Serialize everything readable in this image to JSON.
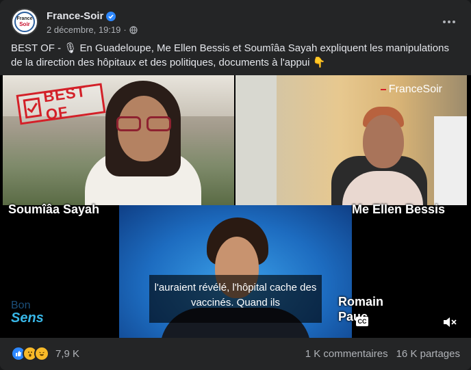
{
  "post": {
    "page_name": "France-Soir",
    "timestamp": "2 décembre, 19:19",
    "separator": "·",
    "caption_prefix": "BEST OF - ",
    "caption_text": " En Guadeloupe, Me Ellen Bessis et Soumîâa Sayah expliquent les manipulations de la direction des hôpitaux et des politiques, documents à l'appui ",
    "mic_emoji": "🎙",
    "point_emoji": "👇",
    "avatar_line1": "France",
    "avatar_line2": "Soir"
  },
  "video": {
    "stamp_text": "BEST OF",
    "logo_text": "FranceSoir",
    "participants": [
      {
        "name": "Soumîâa Sayah"
      },
      {
        "name": "Me Ellen Bessis"
      },
      {
        "name": "Romain Pauc"
      }
    ],
    "subtitle": "l'auraient révélé, l'hôpital cache des vaccinés. Quand ils",
    "show_line1": "Bon",
    "show_line2": "Sens",
    "cc_label": "CC"
  },
  "footer": {
    "reaction_count": "7,9 K",
    "comments": "1 K commentaires",
    "shares": "16 K partages"
  },
  "colors": {
    "background": "#18191a",
    "card": "#242526",
    "text": "#e4e6eb",
    "secondary_text": "#b0b3b8",
    "accent_blue": "#2d88ff",
    "stamp_red": "#d32028"
  },
  "icons": [
    "verified-badge-icon",
    "globe-icon",
    "more-options-icon",
    "checkmark-icon",
    "closed-captions-icon",
    "mute-icon",
    "like-reaction-icon",
    "wow-reaction-icon",
    "haha-reaction-icon"
  ]
}
